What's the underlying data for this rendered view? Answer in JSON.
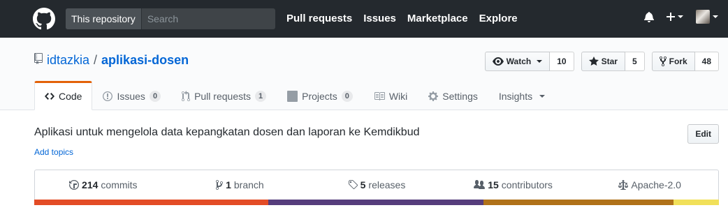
{
  "header": {
    "search_scope": "This repository",
    "search_placeholder": "Search",
    "nav": [
      "Pull requests",
      "Issues",
      "Marketplace",
      "Explore"
    ]
  },
  "repo": {
    "owner": "idtazkia",
    "separator": "/",
    "name": "aplikasi-dosen"
  },
  "actions": {
    "watch_label": "Watch",
    "watch_count": "10",
    "star_label": "Star",
    "star_count": "5",
    "fork_label": "Fork",
    "fork_count": "48"
  },
  "tabs": {
    "code": "Code",
    "issues": "Issues",
    "issues_count": "0",
    "pulls": "Pull requests",
    "pulls_count": "1",
    "projects": "Projects",
    "projects_count": "0",
    "wiki": "Wiki",
    "settings": "Settings",
    "insights": "Insights"
  },
  "description": {
    "text": "Aplikasi untuk mengelola data kepangkatan dosen dan laporan ke Kemdikbud",
    "add_topics": "Add topics",
    "edit_label": "Edit"
  },
  "summary": {
    "commits_num": "214",
    "commits_label": "commits",
    "branch_num": "1",
    "branch_label": "branch",
    "releases_num": "5",
    "releases_label": "releases",
    "contributors_num": "15",
    "contributors_label": "contributors",
    "license": "Apache-2.0"
  },
  "language_bar": [
    {
      "color": "#e34c26",
      "share": 34.2
    },
    {
      "color": "#563d7c",
      "share": 31.4
    },
    {
      "color": "#b07219",
      "share": 27.8
    },
    {
      "color": "#f1e05a",
      "share": 6.6
    }
  ],
  "icons": {
    "logo": "github-mark-icon",
    "notifications": "bell-icon",
    "create": "plus-icon",
    "repo": "repo-book-icon",
    "watch": "eye-icon",
    "star": "star-icon",
    "fork": "repo-forked-icon",
    "code": "code-icon",
    "issues": "issue-opened-icon",
    "pulls": "git-pull-request-icon",
    "projects": "project-icon",
    "wiki": "book-icon",
    "settings": "gear-icon",
    "commits": "history-icon",
    "branch": "git-branch-icon",
    "releases": "tag-icon",
    "contributors": "organization-icon",
    "license": "law-icon"
  }
}
